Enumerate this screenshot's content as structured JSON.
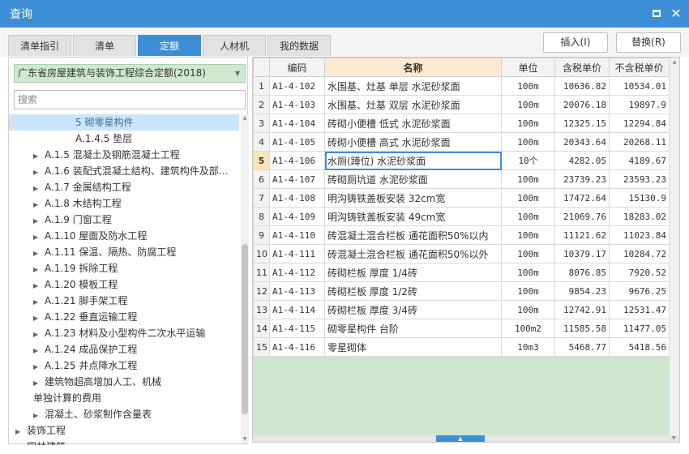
{
  "window": {
    "title": "查询"
  },
  "tabs": [
    {
      "label": "清单指引",
      "active": false
    },
    {
      "label": "清单",
      "active": false
    },
    {
      "label": "定额",
      "active": true
    },
    {
      "label": "人材机",
      "active": false
    },
    {
      "label": "我的数据",
      "active": false
    }
  ],
  "actions": {
    "insert_label": "插入(I)",
    "replace_label": "替换(R)"
  },
  "left_panel": {
    "quota_library": "广东省房屋建筑与装饰工程综合定额(2018)",
    "search_placeholder": "搜索",
    "tree": [
      {
        "label": "5 砌零星构件",
        "level": 3,
        "expandable": false,
        "selected": true
      },
      {
        "label": "A.1.4.5 垫层",
        "level": 3,
        "expandable": false,
        "selected": false
      },
      {
        "label": "A.1.5 混凝土及钢筋混凝土工程",
        "level": 2,
        "expandable": true,
        "selected": false
      },
      {
        "label": "A.1.6 装配式混凝土结构、建筑构件及部…",
        "level": 2,
        "expandable": true,
        "selected": false
      },
      {
        "label": "A.1.7 金属结构工程",
        "level": 2,
        "expandable": true,
        "selected": false
      },
      {
        "label": "A.1.8 木结构工程",
        "level": 2,
        "expandable": true,
        "selected": false
      },
      {
        "label": "A.1.9 门窗工程",
        "level": 2,
        "expandable": true,
        "selected": false
      },
      {
        "label": "A.1.10 屋面及防水工程",
        "level": 2,
        "expandable": true,
        "selected": false
      },
      {
        "label": "A.1.11 保温、隔热、防腐工程",
        "level": 2,
        "expandable": true,
        "selected": false
      },
      {
        "label": "A.1.19 拆除工程",
        "level": 2,
        "expandable": true,
        "selected": false
      },
      {
        "label": "A.1.20 模板工程",
        "level": 2,
        "expandable": true,
        "selected": false
      },
      {
        "label": "A.1.21 脚手架工程",
        "level": 2,
        "expandable": true,
        "selected": false
      },
      {
        "label": "A.1.22 垂直运输工程",
        "level": 2,
        "expandable": true,
        "selected": false
      },
      {
        "label": "A.1.23 材料及小型构件二次水平运输",
        "level": 2,
        "expandable": true,
        "selected": false
      },
      {
        "label": "A.1.24 成品保护工程",
        "level": 2,
        "expandable": true,
        "selected": false
      },
      {
        "label": "A.1.25 井点降水工程",
        "level": 2,
        "expandable": true,
        "selected": false
      },
      {
        "label": "建筑物超高增加人工、机械",
        "level": 2,
        "expandable": true,
        "selected": false
      },
      {
        "label": "单独计算的费用",
        "level": 2,
        "expandable": false,
        "selected": false
      },
      {
        "label": "混凝土、砂浆制作含量表",
        "level": 2,
        "expandable": true,
        "selected": false
      },
      {
        "label": "装饰工程",
        "level": 1,
        "expandable": true,
        "selected": false
      },
      {
        "label": "园林建筑",
        "level": 1,
        "expandable": true,
        "selected": false
      }
    ]
  },
  "grid": {
    "columns": [
      "",
      "编码",
      "名称",
      "单位",
      "含税单价",
      "不含税单价"
    ],
    "current_row": 4,
    "rows": [
      {
        "idx": "1",
        "code": "A1-4-102",
        "name": "水围基、灶基 单层 水泥砂浆面",
        "unit": "100m",
        "tax_price": "10636.82",
        "notax_price": "10534.01"
      },
      {
        "idx": "2",
        "code": "A1-4-103",
        "name": "水围基、灶基 双层 水泥砂浆面",
        "unit": "100m",
        "tax_price": "20076.18",
        "notax_price": "19897.9"
      },
      {
        "idx": "3",
        "code": "A1-4-104",
        "name": "砖砌小便槽 低式 水泥砂浆面",
        "unit": "100m",
        "tax_price": "12325.15",
        "notax_price": "12294.84"
      },
      {
        "idx": "4",
        "code": "A1-4-105",
        "name": "砖砌小便槽 高式 水泥砂浆面",
        "unit": "100m",
        "tax_price": "20343.64",
        "notax_price": "20268.11"
      },
      {
        "idx": "5",
        "code": "A1-4-106",
        "name": "水厕(蹲位) 水泥砂浆面",
        "unit": "10个",
        "tax_price": "4282.05",
        "notax_price": "4189.67"
      },
      {
        "idx": "6",
        "code": "A1-4-107",
        "name": "砖砌厕坑道 水泥砂浆面",
        "unit": "100m",
        "tax_price": "23739.23",
        "notax_price": "23593.23"
      },
      {
        "idx": "7",
        "code": "A1-4-108",
        "name": "明沟铸铁盖板安装 32cm宽",
        "unit": "100m",
        "tax_price": "17472.64",
        "notax_price": "15130.9"
      },
      {
        "idx": "8",
        "code": "A1-4-109",
        "name": "明沟铸铁盖板安装 49cm宽",
        "unit": "100m",
        "tax_price": "21069.76",
        "notax_price": "18283.02"
      },
      {
        "idx": "9",
        "code": "A1-4-110",
        "name": "砖混凝土混合栏板 通花面积50%以内",
        "unit": "100m",
        "tax_price": "11121.62",
        "notax_price": "11023.84"
      },
      {
        "idx": "10",
        "code": "A1-4-111",
        "name": "砖混凝土混合栏板 通花面积50%以外",
        "unit": "100m",
        "tax_price": "10379.17",
        "notax_price": "10284.72"
      },
      {
        "idx": "11",
        "code": "A1-4-112",
        "name": "砖砌栏板 厚度 1/4砖",
        "unit": "100m",
        "tax_price": "8076.85",
        "notax_price": "7920.52"
      },
      {
        "idx": "12",
        "code": "A1-4-113",
        "name": "砖砌栏板 厚度 1/2砖",
        "unit": "100m",
        "tax_price": "9854.23",
        "notax_price": "9676.25"
      },
      {
        "idx": "13",
        "code": "A1-4-114",
        "name": "砖砌栏板 厚度 3/4砖",
        "unit": "100m",
        "tax_price": "12742.91",
        "notax_price": "12531.47"
      },
      {
        "idx": "14",
        "code": "A1-4-115",
        "name": "砌零星构件 台阶",
        "unit": "100m2",
        "tax_price": "11585.58",
        "notax_price": "11477.05"
      },
      {
        "idx": "15",
        "code": "A1-4-116",
        "name": "零星砌体",
        "unit": "10m3",
        "tax_price": "5468.77",
        "notax_price": "5418.56"
      }
    ]
  },
  "colors": {
    "accent": "#3c8fd6",
    "selected_tree": "#cce4f7",
    "grid_bg": "#cde6cd",
    "header_name": "#fde9cf"
  }
}
